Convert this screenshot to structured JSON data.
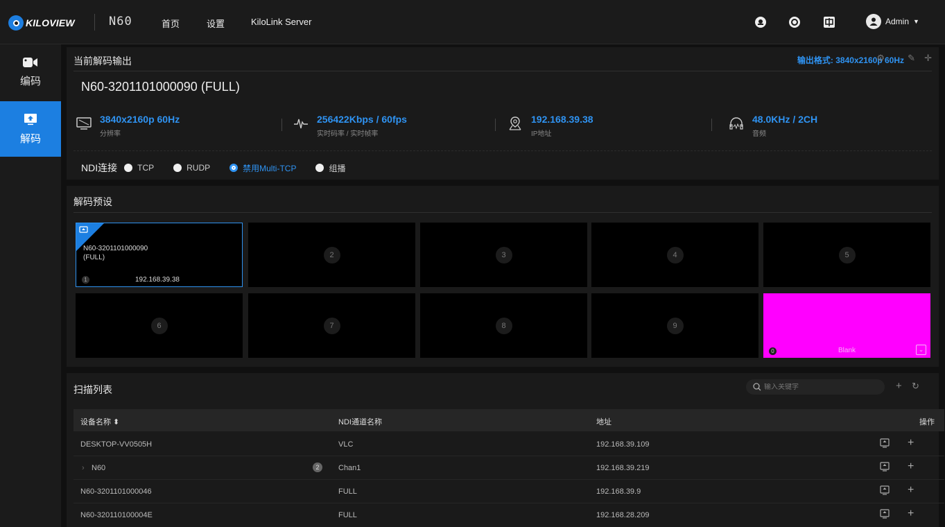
{
  "topbar": {
    "logo_text": "KILOVIEW",
    "model": "N60",
    "nav": [
      "首页",
      "设置",
      "KiloLink Server"
    ],
    "icons": [
      "notification-icon",
      "help-icon",
      "language-icon"
    ],
    "user": "Admin"
  },
  "sidebar": {
    "items": [
      {
        "label": "编码",
        "icon": "camera-icon",
        "active": false
      },
      {
        "label": "解码",
        "icon": "monitor-upload-icon",
        "active": true
      }
    ]
  },
  "output": {
    "title": "当前解码输出",
    "format_label": "输出格式: 3840x2160p 60Hz",
    "source": "N60-3201101000090 (FULL)",
    "stats": [
      {
        "value": "3840x2160p 60Hz",
        "label": "分辨率",
        "icon": "monitor-icon"
      },
      {
        "value": "256422Kbps / 60fps",
        "label": "实时码率 / 实时帧率",
        "icon": "pulse-icon"
      },
      {
        "value": "192.168.39.38",
        "label": "IP地址",
        "icon": "location-icon"
      },
      {
        "value": "48.0KHz / 2CH",
        "label": "音频",
        "icon": "headphones-icon"
      }
    ],
    "ndi_label": "NDI连接",
    "ndi_options": [
      "TCP",
      "RUDP",
      "禁用Multi-TCP",
      "组播"
    ],
    "ndi_selected": 2
  },
  "presets": {
    "title": "解码预设",
    "active": {
      "name_line1": "N60-3201101000090",
      "name_line2": "(FULL)",
      "index": "1",
      "ip": "192.168.39.38"
    },
    "numbers": [
      "2",
      "3",
      "4",
      "5",
      "6",
      "7",
      "8",
      "9"
    ],
    "blank": {
      "index": "0",
      "label": "Blank",
      "color": "#ff00ff"
    }
  },
  "scan": {
    "title": "扫描列表",
    "search_placeholder": "输入关键字",
    "columns": [
      "设备名称 ⬍",
      "NDI通道名称",
      "地址",
      "操作"
    ],
    "rows": [
      {
        "device": "DESKTOP-VV0505H",
        "channel": "VLC",
        "address": "192.168.39.109",
        "badge": ""
      },
      {
        "device": "N60",
        "channel": "Chan1",
        "address": "192.168.39.219",
        "badge": "2"
      },
      {
        "device": "N60-3201101000046",
        "channel": "FULL",
        "address": "192.168.39.9",
        "badge": ""
      },
      {
        "device": "N60-320110100004E",
        "channel": "FULL",
        "address": "192.168.28.209",
        "badge": ""
      }
    ]
  },
  "colors": {
    "accent": "#1c7fe1",
    "accent_text": "#2f93f2",
    "blank": "#ff00ff"
  }
}
